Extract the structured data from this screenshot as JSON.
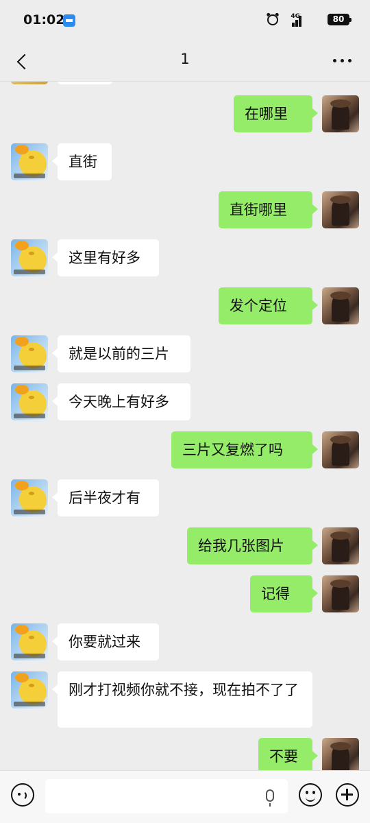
{
  "status": {
    "time": "01:02",
    "network": "4G",
    "battery": "80"
  },
  "header": {
    "title": "1"
  },
  "messages": [
    {
      "side": "out",
      "text": "在哪里"
    },
    {
      "side": "in",
      "text": "直街"
    },
    {
      "side": "out",
      "text": "直街哪里"
    },
    {
      "side": "in",
      "text": "这里有好多"
    },
    {
      "side": "out",
      "text": "发个定位"
    },
    {
      "side": "in",
      "text": "就是以前的三片"
    },
    {
      "side": "in",
      "text": "今天晚上有好多"
    },
    {
      "side": "out",
      "text": "三片又复燃了吗"
    },
    {
      "side": "in",
      "text": "后半夜才有"
    },
    {
      "side": "out",
      "text": "给我几张图片"
    },
    {
      "side": "out",
      "text": "记得"
    },
    {
      "side": "in",
      "text": "你要就过来"
    },
    {
      "side": "in",
      "text": "刚才打视频你就不接，现在拍不了了"
    },
    {
      "side": "out",
      "text": "不要"
    }
  ],
  "input": {
    "placeholder": ""
  },
  "colors": {
    "background": "#ededed",
    "outgoing_bubble": "#95ec69",
    "incoming_bubble": "#ffffff"
  }
}
